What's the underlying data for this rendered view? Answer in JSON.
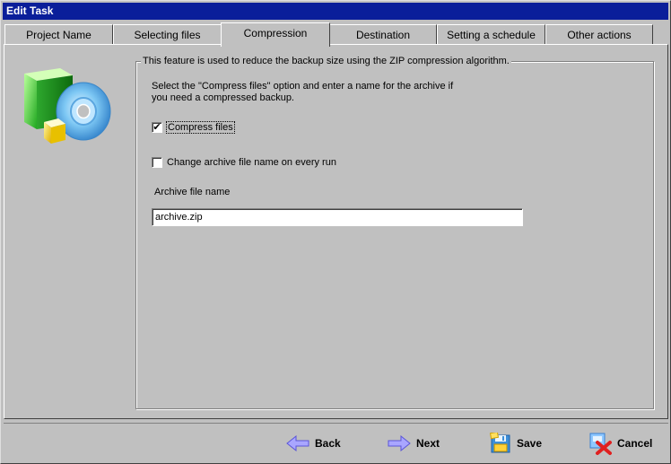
{
  "window": {
    "title": "Edit Task"
  },
  "tabs": [
    {
      "label": "Project Name"
    },
    {
      "label": "Selecting files"
    },
    {
      "label": "Compression"
    },
    {
      "label": "Destination"
    },
    {
      "label": "Setting a schedule"
    },
    {
      "label": "Other actions"
    }
  ],
  "active_tab": "Compression",
  "compression": {
    "group_title": "This feature is used to reduce the backup size using the ZIP compression algorithm.",
    "instructions_line1": "Select the \"Compress files\" option and enter a name for the archive if",
    "instructions_line2": "you need a compressed backup.",
    "compress_files": {
      "label": "Compress files",
      "checked": true,
      "mark": "✔"
    },
    "change_name": {
      "label": "Change archive file name on every run",
      "checked": false
    },
    "archive_label": "Archive file name",
    "archive_value": "archive.zip"
  },
  "buttons": {
    "back": "Back",
    "next": "Next",
    "save": "Save",
    "cancel": "Cancel"
  },
  "icons": {
    "illustration": "compression-box-cd-icon",
    "back": "arrow-left-icon",
    "next": "arrow-right-icon",
    "save": "floppy-disk-icon",
    "cancel": "cancel-x-icon"
  }
}
